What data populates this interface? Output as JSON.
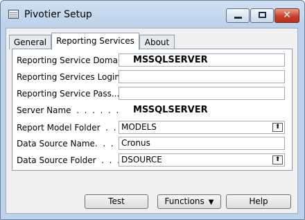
{
  "window": {
    "title": "Pivotier Setup",
    "close_glyph": "✕"
  },
  "tabs": [
    {
      "label": "General"
    },
    {
      "label": "Reporting Services"
    },
    {
      "label": "About"
    }
  ],
  "fields": [
    {
      "label": "Reporting Service Domain",
      "value": "MSSQLSERVER"
    },
    {
      "label": "Reporting Services Login...",
      "value": ""
    },
    {
      "label": "Reporting Service Pass...",
      "value": ""
    },
    {
      "label": "Server Name  .  .  .  .  .  .",
      "value": "MSSQLSERVER"
    },
    {
      "label": "Report Model Folder  .  .  .",
      "value": "MODELS"
    },
    {
      "label": "Data Source Name.  .  .  .",
      "value": "Cronus"
    },
    {
      "label": "Data Source Folder  .  .  .",
      "value": "DSOURCE"
    }
  ],
  "dropdown_glyph": "⬆",
  "buttons": {
    "test": "Test",
    "functions": "Functions",
    "functions_arrow": "▼",
    "help": "Help"
  }
}
